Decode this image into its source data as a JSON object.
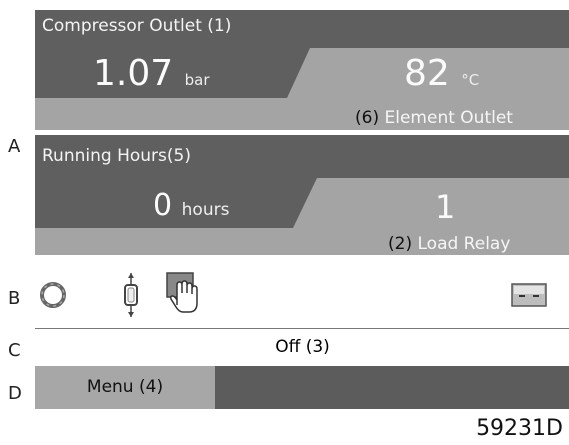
{
  "rows": {
    "a": "A",
    "b": "B",
    "c": "C",
    "d": "D"
  },
  "panel1": {
    "title": "Compressor Outlet",
    "title_ref": "(1)",
    "value": "1.07",
    "unit": "bar",
    "right_value": "82",
    "right_unit": "°C",
    "right_ref": "(6)",
    "right_label": "Element Outlet"
  },
  "panel2": {
    "title": "Running Hours",
    "title_ref": "(5)",
    "value": "0",
    "unit": "hours",
    "right_value": "1",
    "right_ref": "(2)",
    "right_label": "Load Relay"
  },
  "icons": [
    "stopped-ring-icon",
    "regulation-icon",
    "hand-control-icon",
    "service-card-icon"
  ],
  "status": {
    "text": "Off",
    "ref": "(3)"
  },
  "menu": {
    "label": "Menu",
    "ref": "(4)"
  },
  "figure_code": "59231D",
  "colors": {
    "panel_light": "#a4a4a4",
    "panel_dark": "#5f5f5f",
    "menubar": "#5c5c5c"
  }
}
